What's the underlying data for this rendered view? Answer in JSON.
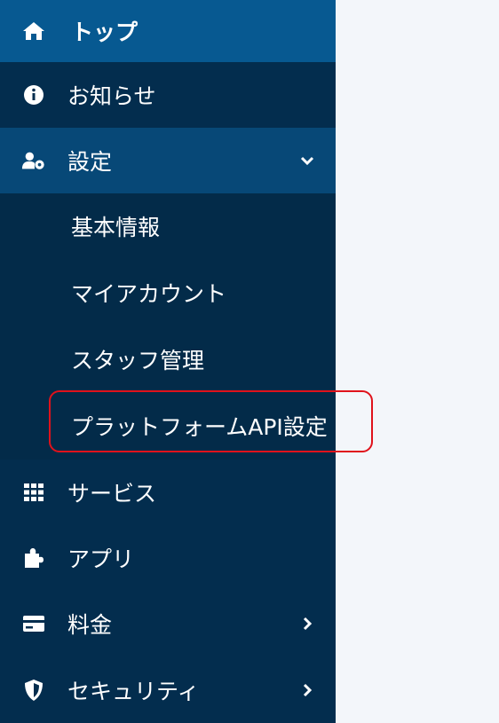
{
  "sidebar": {
    "items": [
      {
        "label": "トップ",
        "icon": "home-icon"
      },
      {
        "label": "お知らせ",
        "icon": "info-icon"
      },
      {
        "label": "設定",
        "icon": "user-settings-icon",
        "expanded": true
      },
      {
        "label": "サービス",
        "icon": "grid-icon"
      },
      {
        "label": "アプリ",
        "icon": "puzzle-icon"
      },
      {
        "label": "料金",
        "icon": "credit-card-icon"
      },
      {
        "label": "セキュリティ",
        "icon": "shield-icon"
      }
    ],
    "settings_submenu": [
      {
        "label": "基本情報"
      },
      {
        "label": "マイアカウント"
      },
      {
        "label": "スタッフ管理"
      },
      {
        "label": "プラットフォームAPI設定"
      }
    ]
  },
  "colors": {
    "sidebar_bg": "#032d4e",
    "active_top_bg": "#075991",
    "expanded_bg": "#074877",
    "highlight_border": "#e0121b",
    "content_bg": "#f3f6fa"
  }
}
